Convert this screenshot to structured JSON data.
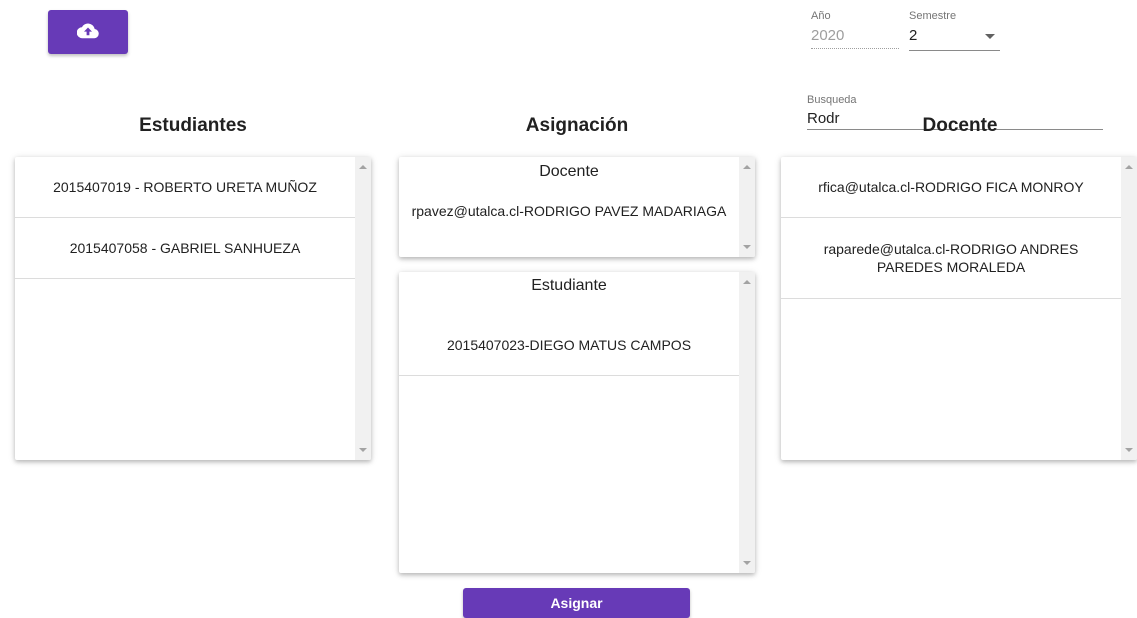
{
  "toolbar": {
    "upload_icon": "cloud-upload-icon"
  },
  "filters": {
    "year": {
      "label": "Año",
      "value": "2020"
    },
    "semester": {
      "label": "Semestre",
      "value": "2",
      "icon": "arrow-drop-down-icon"
    },
    "search": {
      "label": "Busqueda",
      "value": "Rodr"
    }
  },
  "students": {
    "heading": "Estudiantes",
    "items": [
      "2015407019 - ROBERTO URETA MUÑOZ",
      "2015407058 - GABRIEL SANHUEZA"
    ]
  },
  "assignment": {
    "heading": "Asignación",
    "teacher_box": {
      "title": "Docente",
      "value": "rpavez@utalca.cl-RODRIGO PAVEZ MADARIAGA"
    },
    "student_box": {
      "title": "Estudiante",
      "value": "2015407023-DIEGO MATUS CAMPOS"
    },
    "assign_label": "Asignar"
  },
  "teachers": {
    "heading": "Docente",
    "items": [
      "rfica@utalca.cl-RODRIGO FICA MONROY",
      "raparede@utalca.cl-RODRIGO ANDRES PAREDES MORALEDA"
    ]
  },
  "colors": {
    "accent": "#673ab7"
  }
}
